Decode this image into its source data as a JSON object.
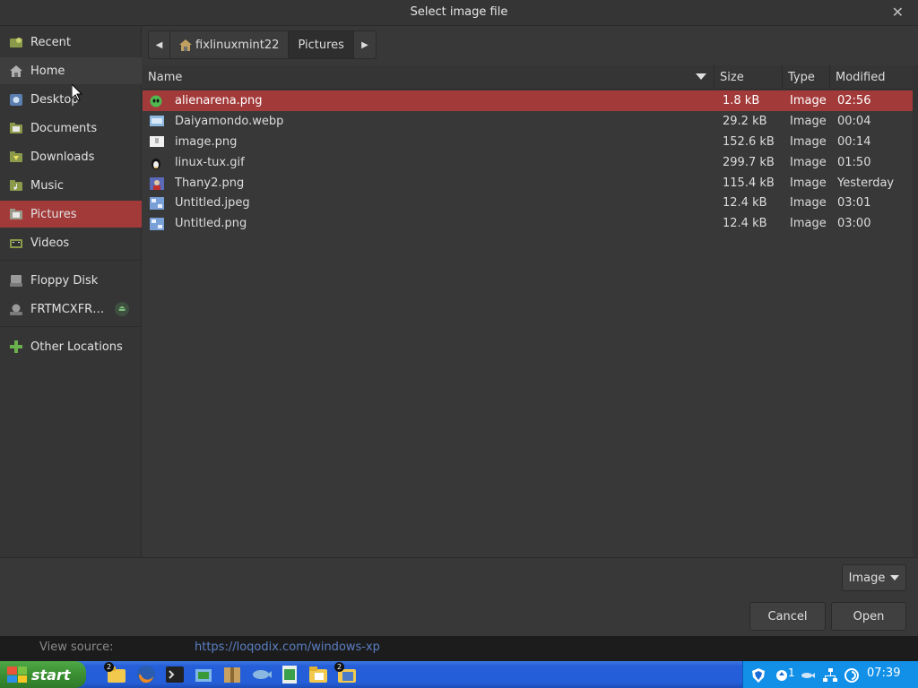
{
  "dialog": {
    "title": "Select image file"
  },
  "sidebar": {
    "items": [
      {
        "label": "Recent",
        "icon": "recent-icon"
      },
      {
        "label": "Home",
        "icon": "home-icon"
      },
      {
        "label": "Desktop",
        "icon": "desktop-icon"
      },
      {
        "label": "Documents",
        "icon": "documents-folder-icon"
      },
      {
        "label": "Downloads",
        "icon": "downloads-folder-icon"
      },
      {
        "label": "Music",
        "icon": "music-folder-icon"
      },
      {
        "label": "Pictures",
        "icon": "pictures-folder-icon"
      },
      {
        "label": "Videos",
        "icon": "videos-folder-icon"
      },
      {
        "label": "Floppy Disk",
        "icon": "floppy-icon"
      },
      {
        "label": "FRTMCXFR…",
        "icon": "drive-icon"
      },
      {
        "label": "Other Locations",
        "icon": "plus-icon"
      }
    ],
    "active": "Pictures"
  },
  "pathbar": {
    "segments": [
      "fixlinuxmint22",
      "Pictures"
    ]
  },
  "columns": {
    "name": "Name",
    "size": "Size",
    "type": "Type",
    "modified": "Modified"
  },
  "files": [
    {
      "name": "alienarena.png",
      "size": "1.8 kB",
      "type": "Image",
      "modified": "02:56",
      "icon": "alien-icon",
      "selected": true
    },
    {
      "name": "Daiyamondo.webp",
      "size": "29.2 kB",
      "type": "Image",
      "modified": "00:04",
      "icon": "image-thumb-icon"
    },
    {
      "name": "image.png",
      "size": "152.6 kB",
      "type": "Image",
      "modified": "00:14",
      "icon": "image-thumb-icon"
    },
    {
      "name": "linux-tux.gif",
      "size": "299.7 kB",
      "type": "Image",
      "modified": "01:50",
      "icon": "tux-icon"
    },
    {
      "name": "Thany2.png",
      "size": "115.4 kB",
      "type": "Image",
      "modified": "Yesterday",
      "icon": "image-thumb-icon"
    },
    {
      "name": "Untitled.jpeg",
      "size": "12.4 kB",
      "type": "Image",
      "modified": "03:01",
      "icon": "image-thumb-icon"
    },
    {
      "name": "Untitled.png",
      "size": "12.4 kB",
      "type": "Image",
      "modified": "03:00",
      "icon": "image-thumb-icon"
    }
  ],
  "filter": {
    "label": "Image"
  },
  "buttons": {
    "cancel": "Cancel",
    "open": "Open"
  },
  "background_page": {
    "label": "View source:",
    "link": "https://loqodix.com/windows-xp"
  },
  "taskbar": {
    "start": "start",
    "badge_1": "2",
    "badge_2": "2",
    "tray_count": "1",
    "clock": "07:39"
  },
  "colors": {
    "selection": "#a33a3a",
    "taskbar": "#245ed8",
    "start": "#3b8f33",
    "tray": "#1290e8"
  }
}
